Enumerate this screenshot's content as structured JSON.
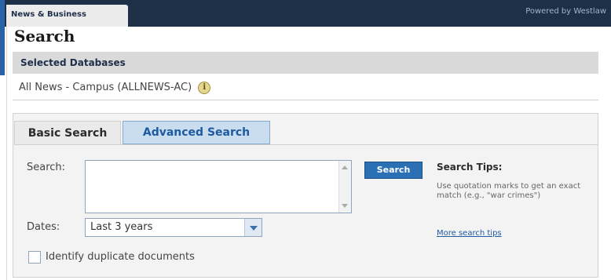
{
  "header": {
    "tab_label": "News & Business",
    "powered_by": "Powered by Westlaw"
  },
  "page": {
    "title": "Search"
  },
  "databases": {
    "header": "Selected Databases",
    "selected": "All News - Campus (ALLNEWS-AC)"
  },
  "tabs": [
    {
      "label": "Basic Search",
      "active": false
    },
    {
      "label": "Advanced Search",
      "active": true
    }
  ],
  "search": {
    "label": "Search:",
    "value": "",
    "button_label": "Search"
  },
  "dates": {
    "label": "Dates:",
    "selected": "Last 3 years"
  },
  "duplicates": {
    "label": "Identify duplicate documents",
    "checked": false
  },
  "tips": {
    "title": "Search Tips:",
    "body": "Use quotation marks to get an exact match (e.g., \"war crimes\")",
    "link_label": "More search tips"
  },
  "colors": {
    "topbar": "#1d3047",
    "accent": "#2b6fb4",
    "link": "#1e5aa0"
  },
  "icons": {
    "info": "info-icon",
    "dropdown": "chevron-down-icon"
  }
}
